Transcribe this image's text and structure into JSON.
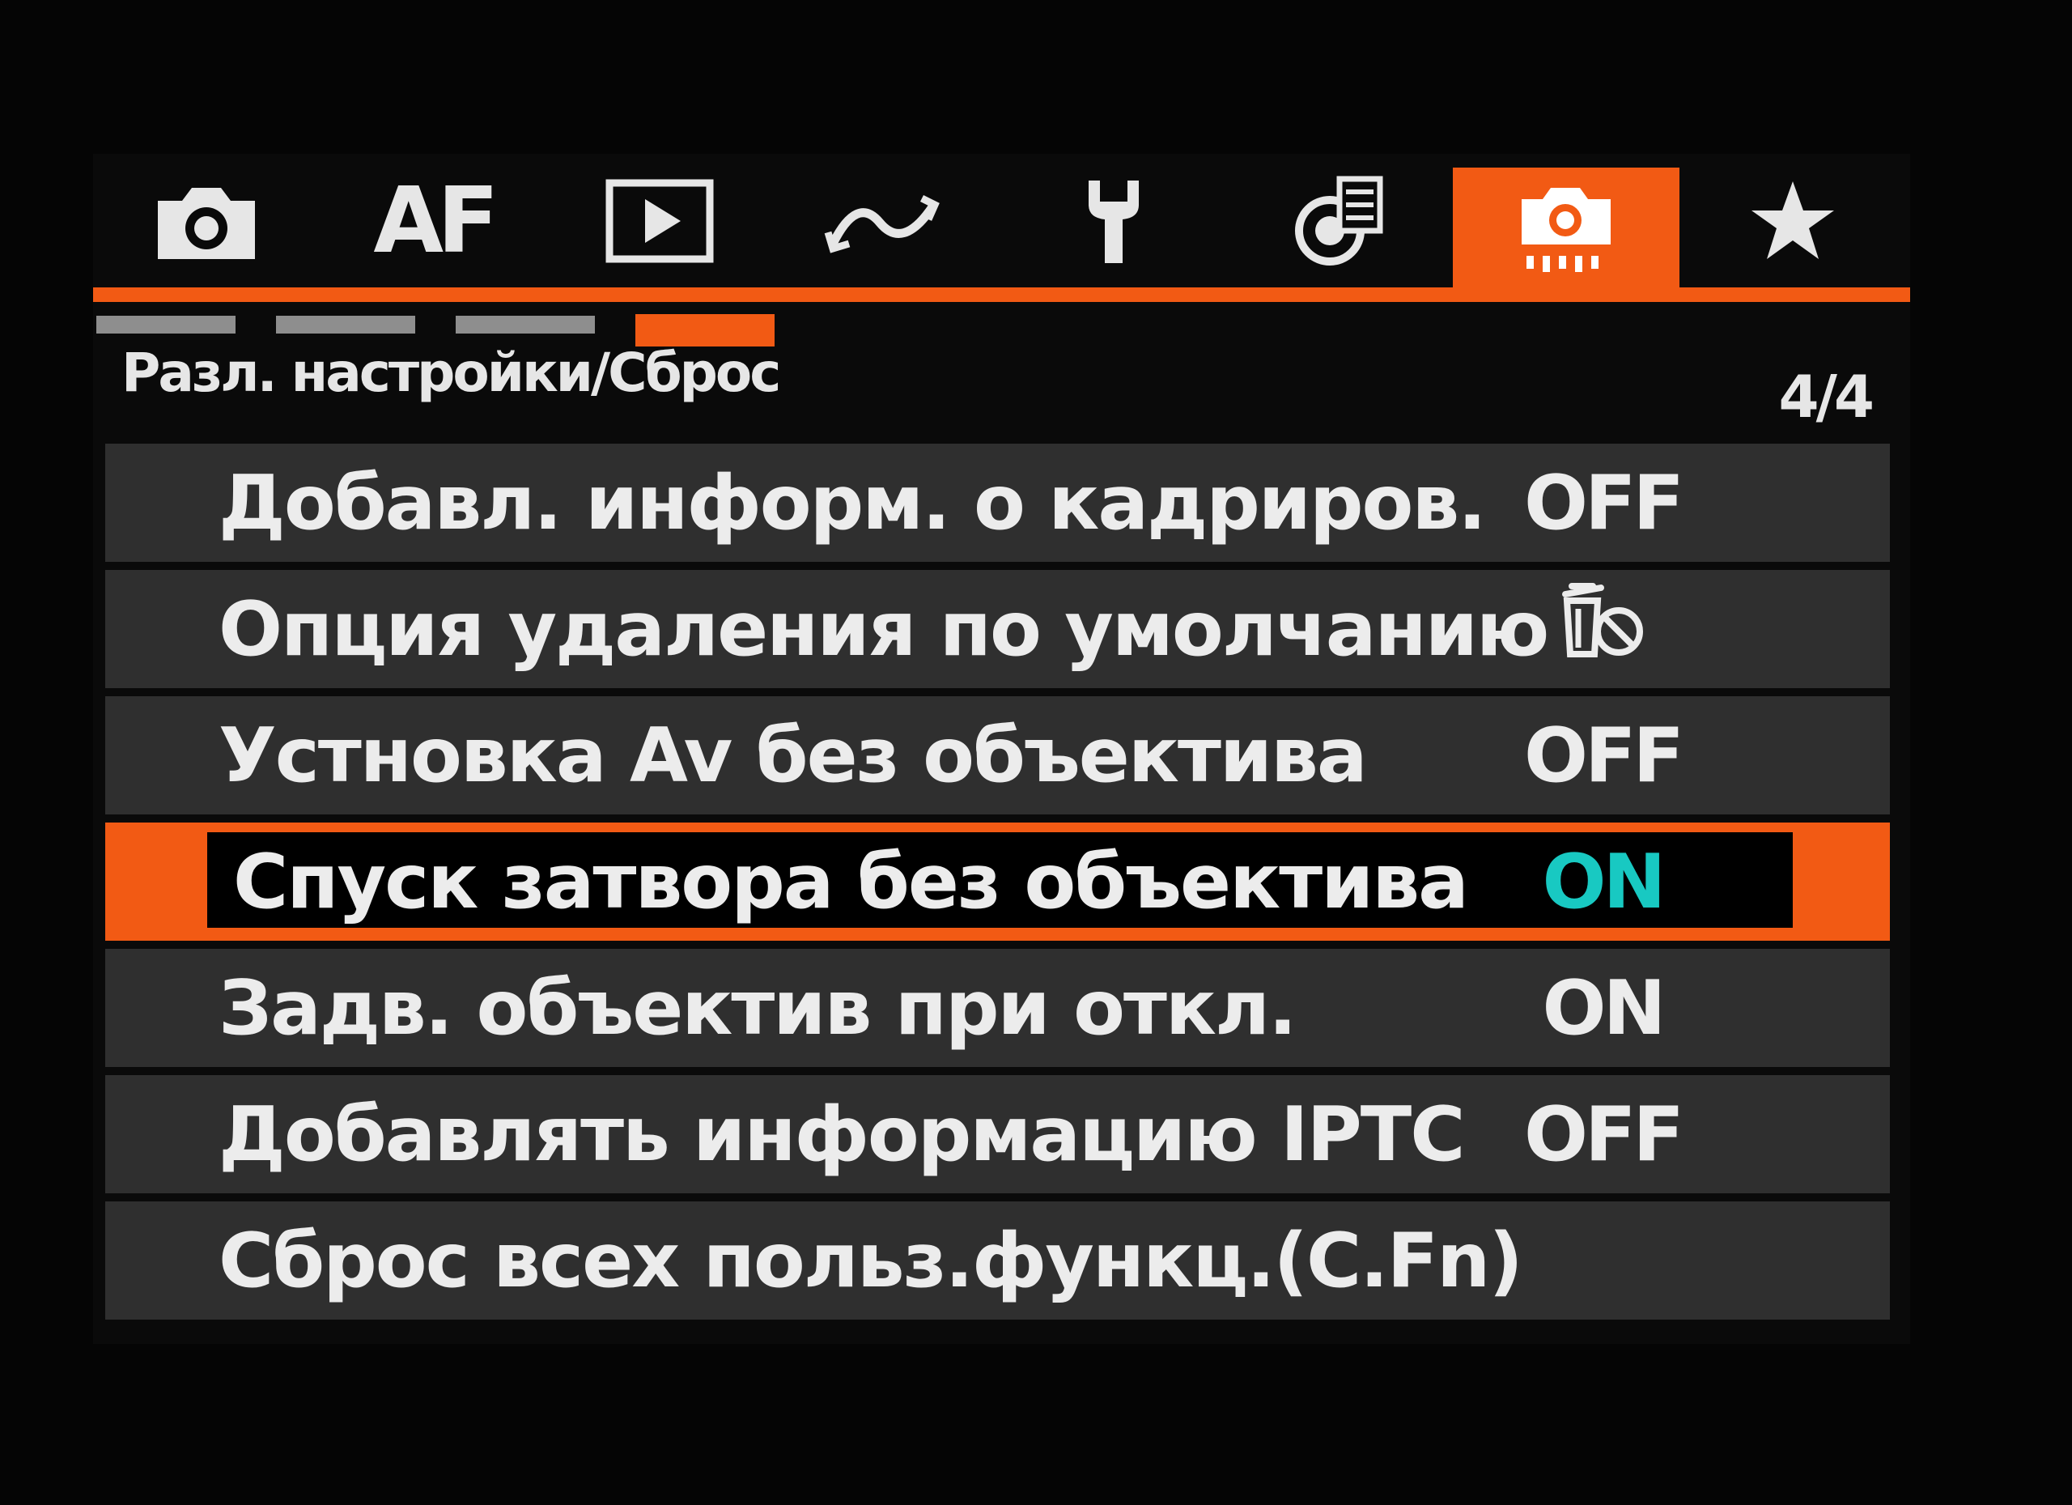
{
  "tabs": [
    {
      "name": "camera",
      "icon": "camera-icon",
      "active": false
    },
    {
      "name": "af",
      "label": "AF",
      "active": false
    },
    {
      "name": "playback",
      "icon": "play-icon",
      "active": false
    },
    {
      "name": "wireless",
      "icon": "wireless-icon",
      "active": false
    },
    {
      "name": "setup",
      "icon": "wrench-icon",
      "active": false
    },
    {
      "name": "custom-shooting",
      "icon": "dial-list-icon",
      "active": false
    },
    {
      "name": "custom-functions",
      "icon": "camera-custom-icon",
      "active": true
    },
    {
      "name": "my-menu",
      "icon": "star-icon",
      "active": false
    }
  ],
  "page_indicator_active": 4,
  "section": {
    "title": "Разл. настройки/Сброс",
    "page": "4/4"
  },
  "menu": {
    "items": [
      {
        "label": "Добавл. информ. о кадриров.",
        "value": "OFF"
      },
      {
        "label": "Опция удаления по умолчанию",
        "value": "",
        "icon": "erase-cancel-icon"
      },
      {
        "label": "Устновка Av без объектива",
        "value": "OFF"
      },
      {
        "label": "Спуск затвора без объектива",
        "value": "ON",
        "selected": true
      },
      {
        "label": "Задв. объектив при откл.",
        "value": "ON"
      },
      {
        "label": "Добавлять информацию IPTC",
        "value": "OFF"
      },
      {
        "label": "Сброс всех польз.функц.(C.Fn)",
        "value": ""
      }
    ]
  },
  "colors": {
    "accent": "#f25a14",
    "selected_value": "#18c9c2",
    "row_bg": "#2f2f2f",
    "text": "#ececec"
  }
}
